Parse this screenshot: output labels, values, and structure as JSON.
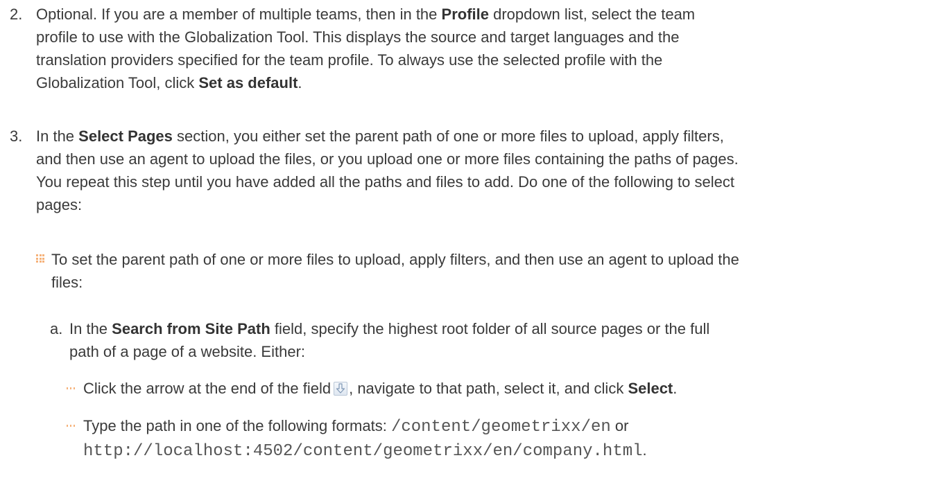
{
  "step2": {
    "number": "2.",
    "t1": "Optional. If you are a member of multiple teams, then in the ",
    "b1": "Profile",
    "t2": " dropdown list, select the team",
    "t3": "profile to use with the Globalization Tool. This displays the source and target languages and the",
    "t4": "translation providers specified for the team profile. To always use the selected profile with the",
    "t5": "Globalization Tool, click ",
    "b2": "Set as default",
    "t6": "."
  },
  "step3": {
    "number": "3.",
    "t1": "In the ",
    "b1": "Select Pages",
    "t2": " section, you either set the parent path of one or more files to upload, apply filters,",
    "t3": "and then use an agent to upload the files, or you upload one or more files containing the paths of pages.",
    "t4": "You repeat this step until you have added all the paths and files to add. Do one of the following to select",
    "t5": "pages:"
  },
  "bullet1": {
    "l1": "To set the parent path of one or more files to upload, apply filters, and then use an agent to upload the",
    "l2": "files:"
  },
  "substep_a": {
    "letter": "a.",
    "t1": "In the ",
    "b1": "Search from Site Path",
    "t2": " field, specify the highest root folder of all source pages or the full",
    "t3": "path of a page of a website. Either:"
  },
  "sub_bullet1": {
    "t1": "Click the arrow at the end of the field",
    "icon": "arrow-down-icon",
    "t2": ", navigate to that path, select it, and click ",
    "b1": "Select",
    "t3": "."
  },
  "sub_bullet2": {
    "t1": "Type the path in one of the following formats: ",
    "code1": "/content/geometrixx/en",
    "t2": " or",
    "code2": "http://localhost:4502/content/geometrixx/en/company.html",
    "t3": "."
  },
  "colors": {
    "text": "#3a3a3a",
    "bullet": "#f6b27a"
  }
}
